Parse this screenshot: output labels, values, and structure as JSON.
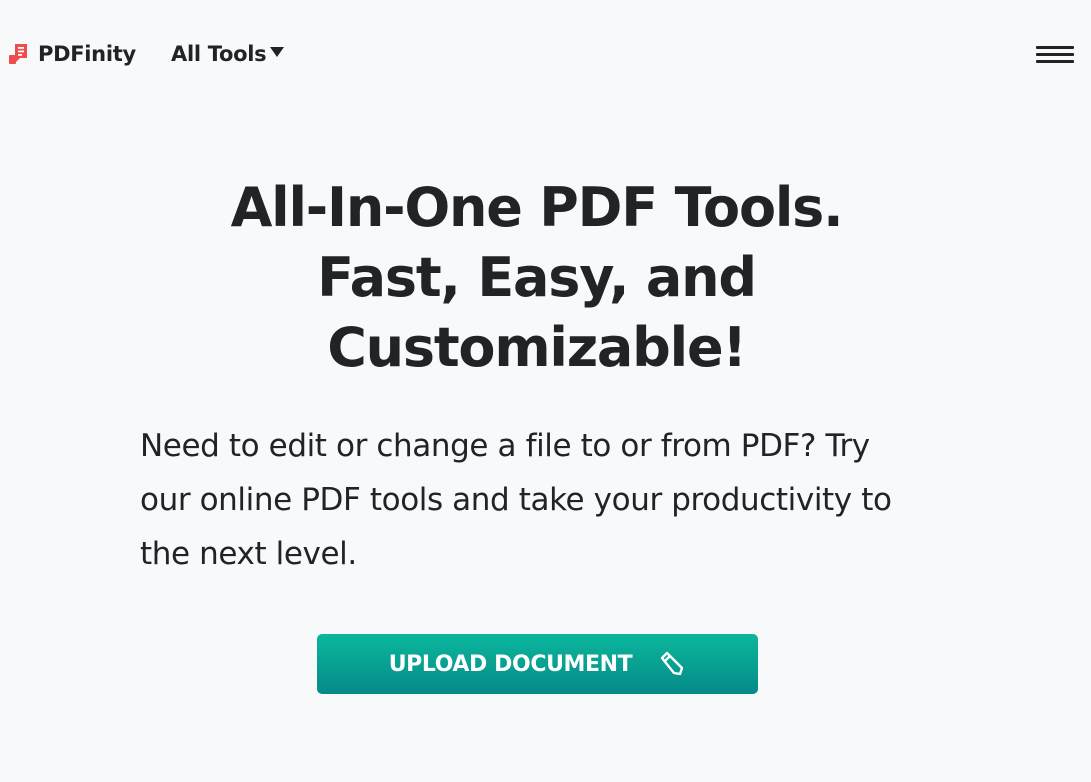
{
  "header": {
    "brand": "PDFinity",
    "nav": {
      "all_tools_label": "All Tools"
    }
  },
  "hero": {
    "title_lines": [
      "All-In-One PDF Tools.",
      "Fast, Easy, and",
      "Customizable!"
    ],
    "subtitle_lines": [
      "Need to edit or change a file to or from PDF? Try",
      "our online PDF tools and take your productivity to",
      "the next level."
    ],
    "upload_button_label": "UPLOAD DOCUMENT"
  },
  "icons": {
    "logo": "pdf-document-icon",
    "nav_caret": "caret-down-icon",
    "menu": "hamburger-menu-icon",
    "upload": "pencil-icon"
  },
  "colors": {
    "brand_red": "#ef4d4d",
    "text": "#222326",
    "background": "#f8f9fb",
    "button_top": "#0bb79c",
    "button_bottom": "#058a88"
  }
}
